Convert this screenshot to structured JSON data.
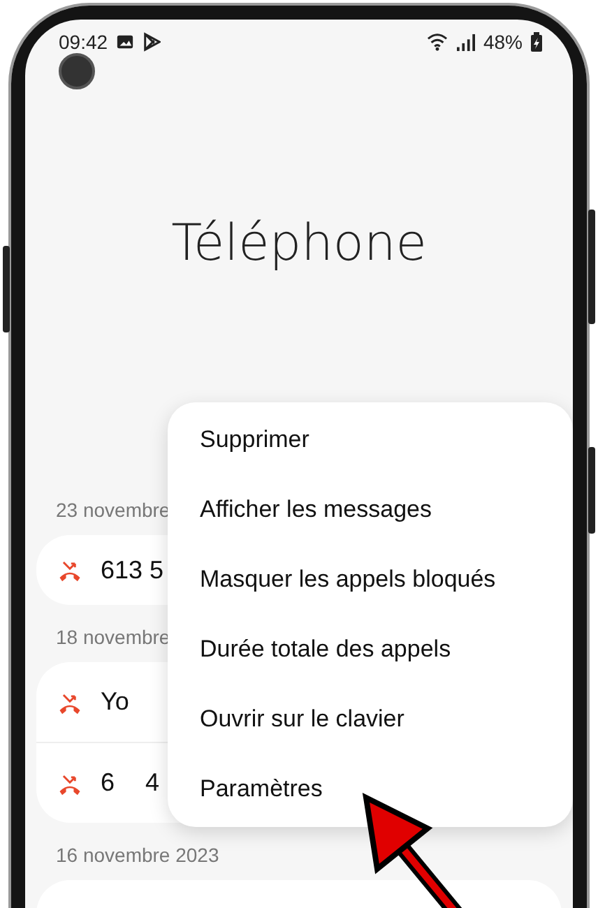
{
  "status_bar": {
    "time": "09:42",
    "battery": "48%"
  },
  "title": "Téléphone",
  "call_groups": [
    {
      "date": "23 novembre",
      "calls": [
        {
          "kind": "missed",
          "name": [
            "613 5"
          ]
        }
      ]
    },
    {
      "date": "18 novembre",
      "calls": [
        {
          "kind": "missed",
          "name": [
            "Yo"
          ]
        },
        {
          "kind": "missed",
          "name": [
            "6",
            "4"
          ]
        }
      ]
    },
    {
      "date": "16 novembre 2023"
    }
  ],
  "menu": {
    "items": [
      "Supprimer",
      "Afficher les messages",
      "Masquer les appels bloqués",
      "Durée totale des appels",
      "Ouvrir sur le clavier",
      "Paramètres"
    ]
  }
}
